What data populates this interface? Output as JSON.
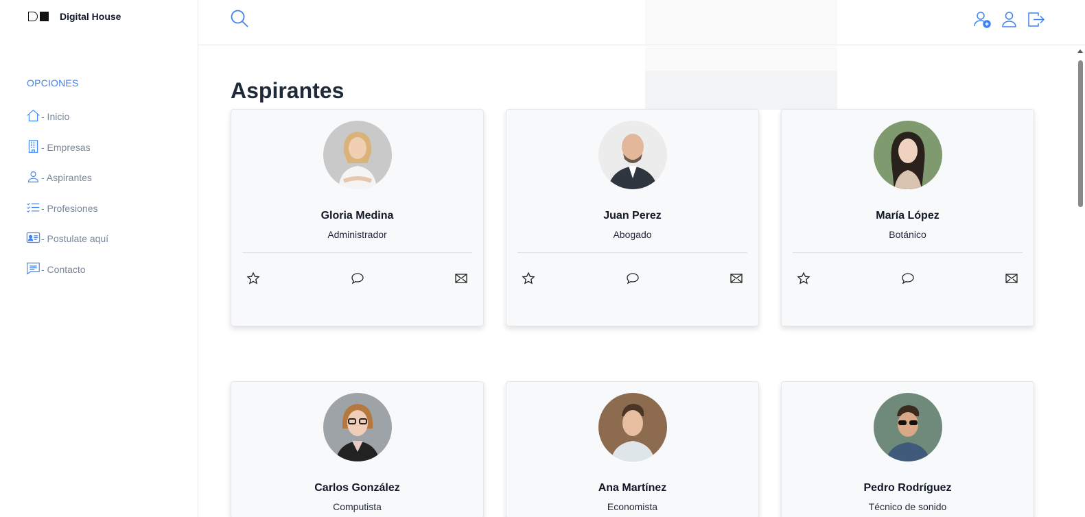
{
  "brand": {
    "name": "Digital House"
  },
  "sidebar": {
    "section_title": "OPCIONES",
    "items": [
      {
        "label": "- Inicio",
        "icon": "home-icon"
      },
      {
        "label": "- Empresas",
        "icon": "building-icon"
      },
      {
        "label": "- Aspirantes",
        "icon": "person-icon"
      },
      {
        "label": "- Profesiones",
        "icon": "list-check-icon"
      },
      {
        "label": "- Postulate aquí",
        "icon": "id-card-icon"
      },
      {
        "label": "- Contacto",
        "icon": "chat-text-icon"
      }
    ]
  },
  "topbar": {
    "icons": [
      "search-icon",
      "add-user-icon",
      "user-icon",
      "logout-icon"
    ]
  },
  "main": {
    "title": "Aspirantes",
    "cards": [
      {
        "name": "Gloria Medina",
        "role": "Administrador"
      },
      {
        "name": "Juan Perez",
        "role": "Abogado"
      },
      {
        "name": "María López",
        "role": "Botánico"
      },
      {
        "name": "Carlos González",
        "role": "Computista"
      },
      {
        "name": "Ana Martínez",
        "role": "Economista"
      },
      {
        "name": "Pedro Rodríguez",
        "role": "Técnico de sonido"
      }
    ],
    "card_actions": [
      "star-icon",
      "chat-icon",
      "envelope-icon"
    ]
  },
  "colors": {
    "accent": "#3b82f6",
    "card_bg": "#f8f9fa",
    "muted_text": "#7a8799"
  }
}
